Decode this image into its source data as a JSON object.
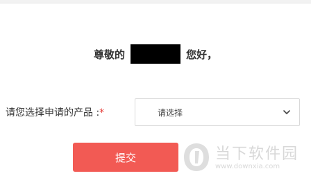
{
  "greeting": {
    "prefix": "尊敬的",
    "suffix": "您好，"
  },
  "form": {
    "product_label": "请您选择申请的产品 :",
    "required_mark": "*",
    "product_select_value": "请选择"
  },
  "actions": {
    "submit_label": "提交"
  },
  "watermark": {
    "brand": "当下软件园",
    "url": "www.downxia.com"
  },
  "icons": {
    "select_arrow": "chevron-down-icon",
    "watermark_logo": "downxia-logo-icon"
  },
  "colors": {
    "submit_button": "#f25a54",
    "required_mark": "#e53935",
    "text": "#333333"
  }
}
